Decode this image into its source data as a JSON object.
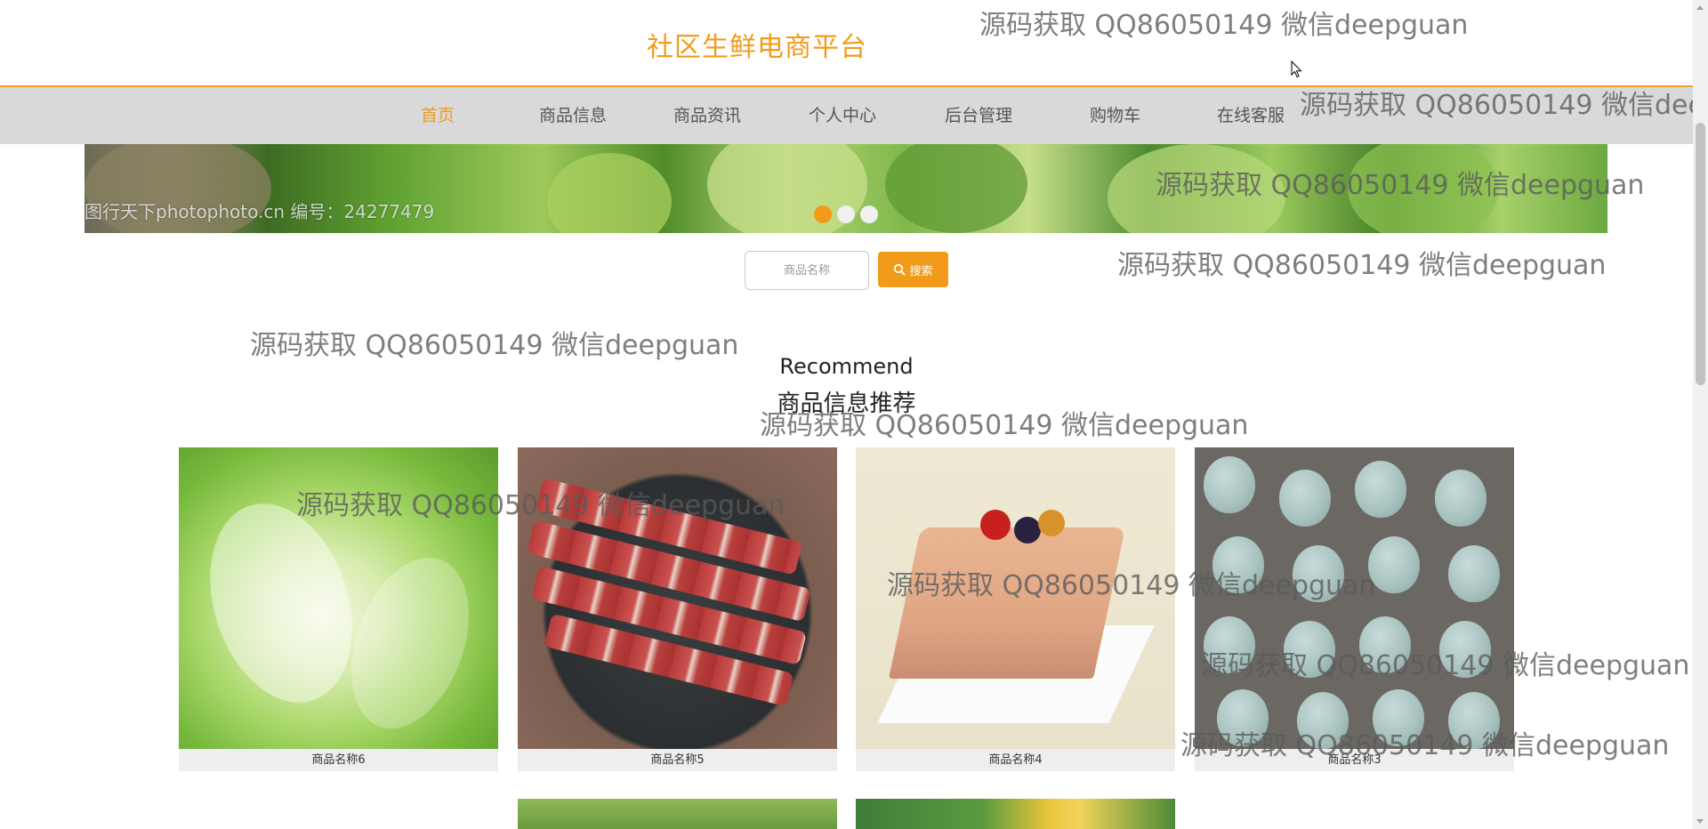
{
  "header": {
    "site_title": "社区生鲜电商平台"
  },
  "nav": {
    "items": [
      {
        "label": "首页",
        "active": true
      },
      {
        "label": "商品信息",
        "active": false
      },
      {
        "label": "商品资讯",
        "active": false
      },
      {
        "label": "个人中心",
        "active": false
      },
      {
        "label": "后台管理",
        "active": false
      },
      {
        "label": "购物车",
        "active": false
      },
      {
        "label": "在线客服",
        "active": false
      }
    ]
  },
  "banner": {
    "credit": "图行天下photophoto.cn  编号：24277479",
    "slide_count": 3,
    "active_slide": 1
  },
  "search": {
    "placeholder": "商品名称",
    "button_label": "搜索",
    "button_icon": "search-icon"
  },
  "section": {
    "title_en": "Recommend",
    "title_cn": "商品信息推荐"
  },
  "products": [
    {
      "name": "商品名称6",
      "image": "cabbage"
    },
    {
      "name": "商品名称5",
      "image": "meat"
    },
    {
      "name": "商品名称4",
      "image": "cake"
    },
    {
      "name": "商品名称3",
      "image": "eggs"
    },
    {
      "name": "",
      "image": "leafy-greens"
    },
    {
      "name": "",
      "image": "corn"
    }
  ],
  "watermark": {
    "text": "源码获取 QQ86050149 微信deepguan"
  },
  "colors": {
    "accent": "#f29b1a",
    "nav_bg": "#d9d9d9",
    "caption_bg": "#eeeeee"
  }
}
